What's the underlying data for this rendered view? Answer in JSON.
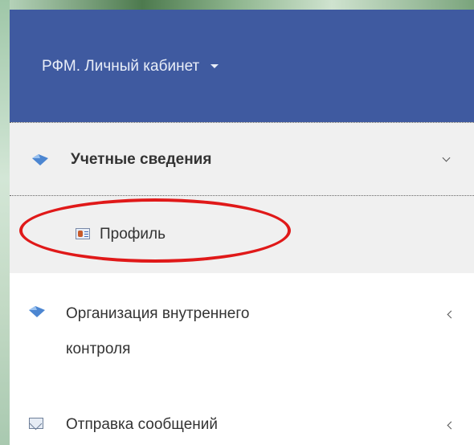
{
  "navbar": {
    "brand_label": "РФМ. Личный кабинет"
  },
  "menu": {
    "sections": [
      {
        "label": "Учетные сведения",
        "expanded": true,
        "items": [
          {
            "label": "Профиль",
            "icon": "profile-card-icon",
            "highlighted": true
          }
        ]
      },
      {
        "label_line1": "Организация внутреннего",
        "label_line2": "контроля",
        "expanded": false
      },
      {
        "label": "Отправка сообщений",
        "expanded": false
      }
    ]
  },
  "colors": {
    "navbar": "#3f5aa0",
    "highlight_ellipse": "#e01919",
    "active_section_bg": "#f0f0f0"
  }
}
